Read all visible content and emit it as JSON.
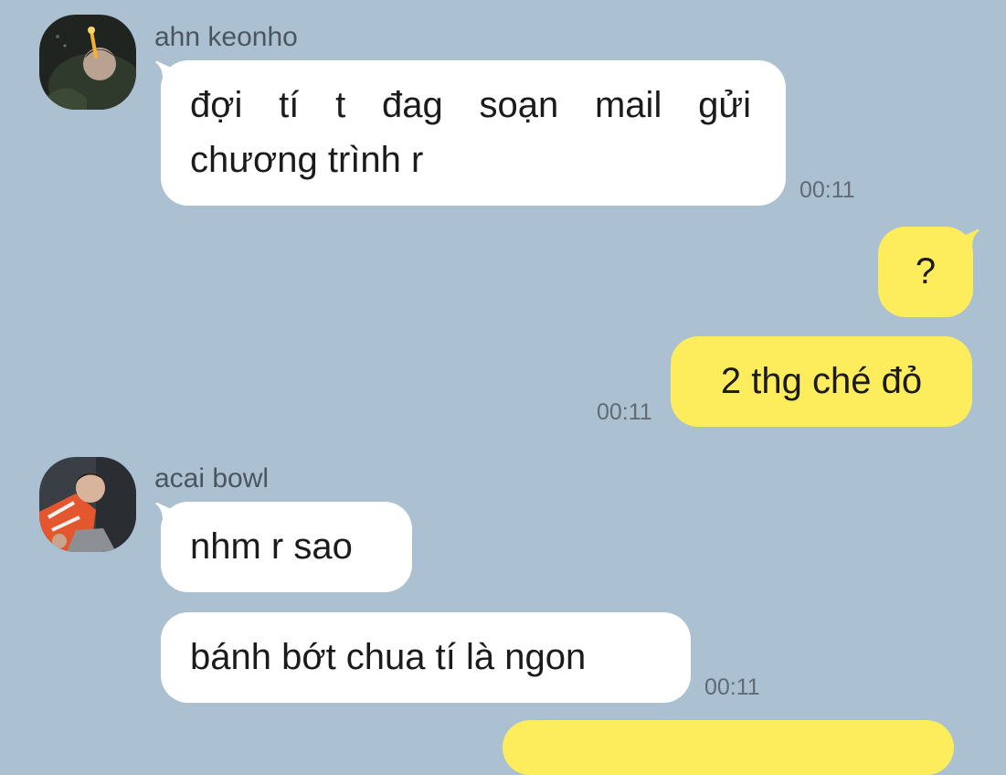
{
  "colors": {
    "background": "#abc1d1",
    "incoming_bubble": "#ffffff",
    "outgoing_bubble": "#fdec5c",
    "name_text": "#4a5560",
    "time_text": "#5f6b76"
  },
  "messages": [
    {
      "sender": "ahn keonho",
      "direction": "incoming",
      "avatar_icon": "profile-photo-icon",
      "lines": [
        "đợi tí t đag soạn mail gửi",
        "chương trình r"
      ],
      "time": "00:11"
    },
    {
      "direction": "outgoing",
      "text": "?"
    },
    {
      "direction": "outgoing",
      "text": "2 thg ché đỏ",
      "time": "00:11"
    },
    {
      "sender": "acai bowl",
      "direction": "incoming",
      "avatar_icon": "profile-photo-icon",
      "text": "nhm r sao"
    },
    {
      "direction": "incoming",
      "text": "bánh bớt chua tí là ngon",
      "time": "00:11"
    }
  ]
}
